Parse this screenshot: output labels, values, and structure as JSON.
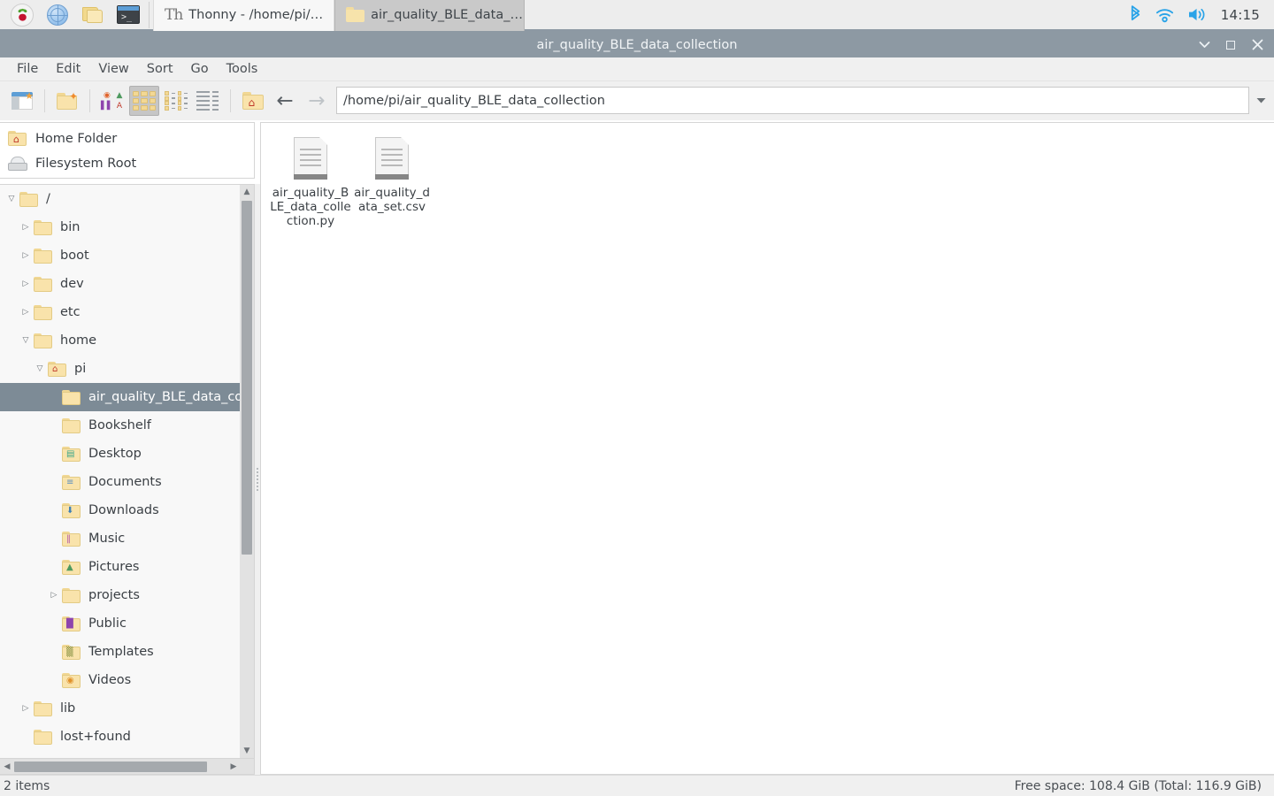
{
  "taskbar": {
    "launcher_icons": [
      {
        "name": "raspberry-pi-menu-icon",
        "glyph": "raspberry"
      },
      {
        "name": "web-browser-icon",
        "glyph": "globe"
      },
      {
        "name": "file-manager-icon",
        "glyph": "folders"
      },
      {
        "name": "terminal-icon",
        "glyph": "terminal",
        "prompt": ">_"
      }
    ],
    "windows": [
      {
        "label": "Thonny  -  /home/pi/…",
        "icon": "thonny-icon",
        "icon_text": "Th",
        "active": false
      },
      {
        "label": "air_quality_BLE_data_…",
        "icon": "folder-icon",
        "active": true
      }
    ],
    "tray": [
      {
        "name": "bluetooth-icon",
        "glyph": "ᛦ"
      },
      {
        "name": "wifi-icon",
        "glyph": "wifi"
      },
      {
        "name": "volume-icon",
        "glyph": "speaker"
      }
    ],
    "clock": "14:15",
    "accent_color": "#29a3e8"
  },
  "window": {
    "title": "air_quality_BLE_data_collection",
    "titlebar_color": "#8d99a3",
    "controls": [
      {
        "name": "minimize-button",
        "glyph": "⌄"
      },
      {
        "name": "maximize-button",
        "glyph": "square"
      },
      {
        "name": "close-button",
        "glyph": "✕"
      }
    ]
  },
  "menubar": {
    "items": [
      "File",
      "Edit",
      "View",
      "Sort",
      "Go",
      "Tools"
    ]
  },
  "toolbar": {
    "buttons": [
      {
        "name": "new-window-button",
        "icon": "new-window-icon"
      },
      {
        "name": "new-folder-button",
        "icon": "new-folder-icon"
      },
      {
        "name": "icon-view-button",
        "icon": "thumbnail-view-icon",
        "active": false
      },
      {
        "name": "grid-view-button",
        "icon": "grid-view-icon",
        "active": true
      },
      {
        "name": "compact-view-button",
        "icon": "compact-list-icon",
        "active": false
      },
      {
        "name": "detailed-view-button",
        "icon": "detailed-list-icon",
        "active": false
      },
      {
        "name": "home-button",
        "icon": "home-folder-icon"
      },
      {
        "name": "back-button",
        "icon": "arrow-left-icon",
        "glyph": "←",
        "enabled": true
      },
      {
        "name": "forward-button",
        "icon": "arrow-right-icon",
        "glyph": "→",
        "enabled": false
      },
      {
        "name": "up-button",
        "icon": "arrow-up-icon",
        "glyph": "↑",
        "enabled": true
      }
    ],
    "path_value": "/home/pi/air_quality_BLE_data_collection",
    "path_placeholder": "Enter location",
    "path_dropdown_icon": "chevron-down-icon"
  },
  "sidebar": {
    "places": [
      {
        "label": "Home Folder",
        "icon": "home-folder-icon"
      },
      {
        "label": "Filesystem Root",
        "icon": "drive-icon"
      }
    ],
    "tree": [
      {
        "label": "/",
        "indent": 0,
        "twist": "open",
        "icon": "folder-icon",
        "overlay": "",
        "selected": false
      },
      {
        "label": "bin",
        "indent": 1,
        "twist": "closed",
        "icon": "folder-icon",
        "overlay": "",
        "selected": false
      },
      {
        "label": "boot",
        "indent": 1,
        "twist": "closed",
        "icon": "folder-icon",
        "overlay": "",
        "selected": false
      },
      {
        "label": "dev",
        "indent": 1,
        "twist": "closed",
        "icon": "folder-icon",
        "overlay": "",
        "selected": false
      },
      {
        "label": "etc",
        "indent": 1,
        "twist": "closed",
        "icon": "folder-icon",
        "overlay": "",
        "selected": false
      },
      {
        "label": "home",
        "indent": 1,
        "twist": "open",
        "icon": "folder-icon",
        "overlay": "",
        "selected": false
      },
      {
        "label": "pi",
        "indent": 2,
        "twist": "open",
        "icon": "home-folder-icon",
        "overlay": "⌂",
        "selected": false
      },
      {
        "label": "air_quality_BLE_data_colle",
        "indent": 3,
        "twist": "none",
        "icon": "folder-icon",
        "overlay": "",
        "selected": true
      },
      {
        "label": "Bookshelf",
        "indent": 3,
        "twist": "none",
        "icon": "folder-icon",
        "overlay": "",
        "selected": false
      },
      {
        "label": "Desktop",
        "indent": 3,
        "twist": "none",
        "icon": "desktop-folder-icon",
        "overlay": "▤",
        "selected": false
      },
      {
        "label": "Documents",
        "indent": 3,
        "twist": "none",
        "icon": "documents-folder-icon",
        "overlay": "≡",
        "selected": false
      },
      {
        "label": "Downloads",
        "indent": 3,
        "twist": "none",
        "icon": "downloads-folder-icon",
        "overlay": "⬇",
        "selected": false
      },
      {
        "label": "Music",
        "indent": 3,
        "twist": "none",
        "icon": "music-folder-icon",
        "overlay": "‖",
        "selected": false
      },
      {
        "label": "Pictures",
        "indent": 3,
        "twist": "none",
        "icon": "pictures-folder-icon",
        "overlay": "▲",
        "selected": false
      },
      {
        "label": "projects",
        "indent": 3,
        "twist": "closed",
        "icon": "folder-icon",
        "overlay": "",
        "selected": false
      },
      {
        "label": "Public",
        "indent": 3,
        "twist": "none",
        "icon": "public-folder-icon",
        "overlay": "█",
        "selected": false
      },
      {
        "label": "Templates",
        "indent": 3,
        "twist": "none",
        "icon": "templates-folder-icon",
        "overlay": "▒",
        "selected": false
      },
      {
        "label": "Videos",
        "indent": 3,
        "twist": "none",
        "icon": "videos-folder-icon",
        "overlay": "◉",
        "selected": false
      },
      {
        "label": "lib",
        "indent": 1,
        "twist": "closed",
        "icon": "folder-icon",
        "overlay": "",
        "selected": false
      },
      {
        "label": "lost+found",
        "indent": 1,
        "twist": "none",
        "icon": "folder-icon",
        "overlay": "",
        "selected": false
      }
    ],
    "selection_color": "#7d8b96"
  },
  "files": [
    {
      "name": "air_quality_BLE_data_collection.py",
      "icon": "text-document-icon"
    },
    {
      "name": "air_quality_data_set.csv",
      "icon": "text-document-icon"
    }
  ],
  "statusbar": {
    "left": "2 items",
    "right": "Free space: 108.4 GiB (Total: 116.9 GiB)"
  }
}
